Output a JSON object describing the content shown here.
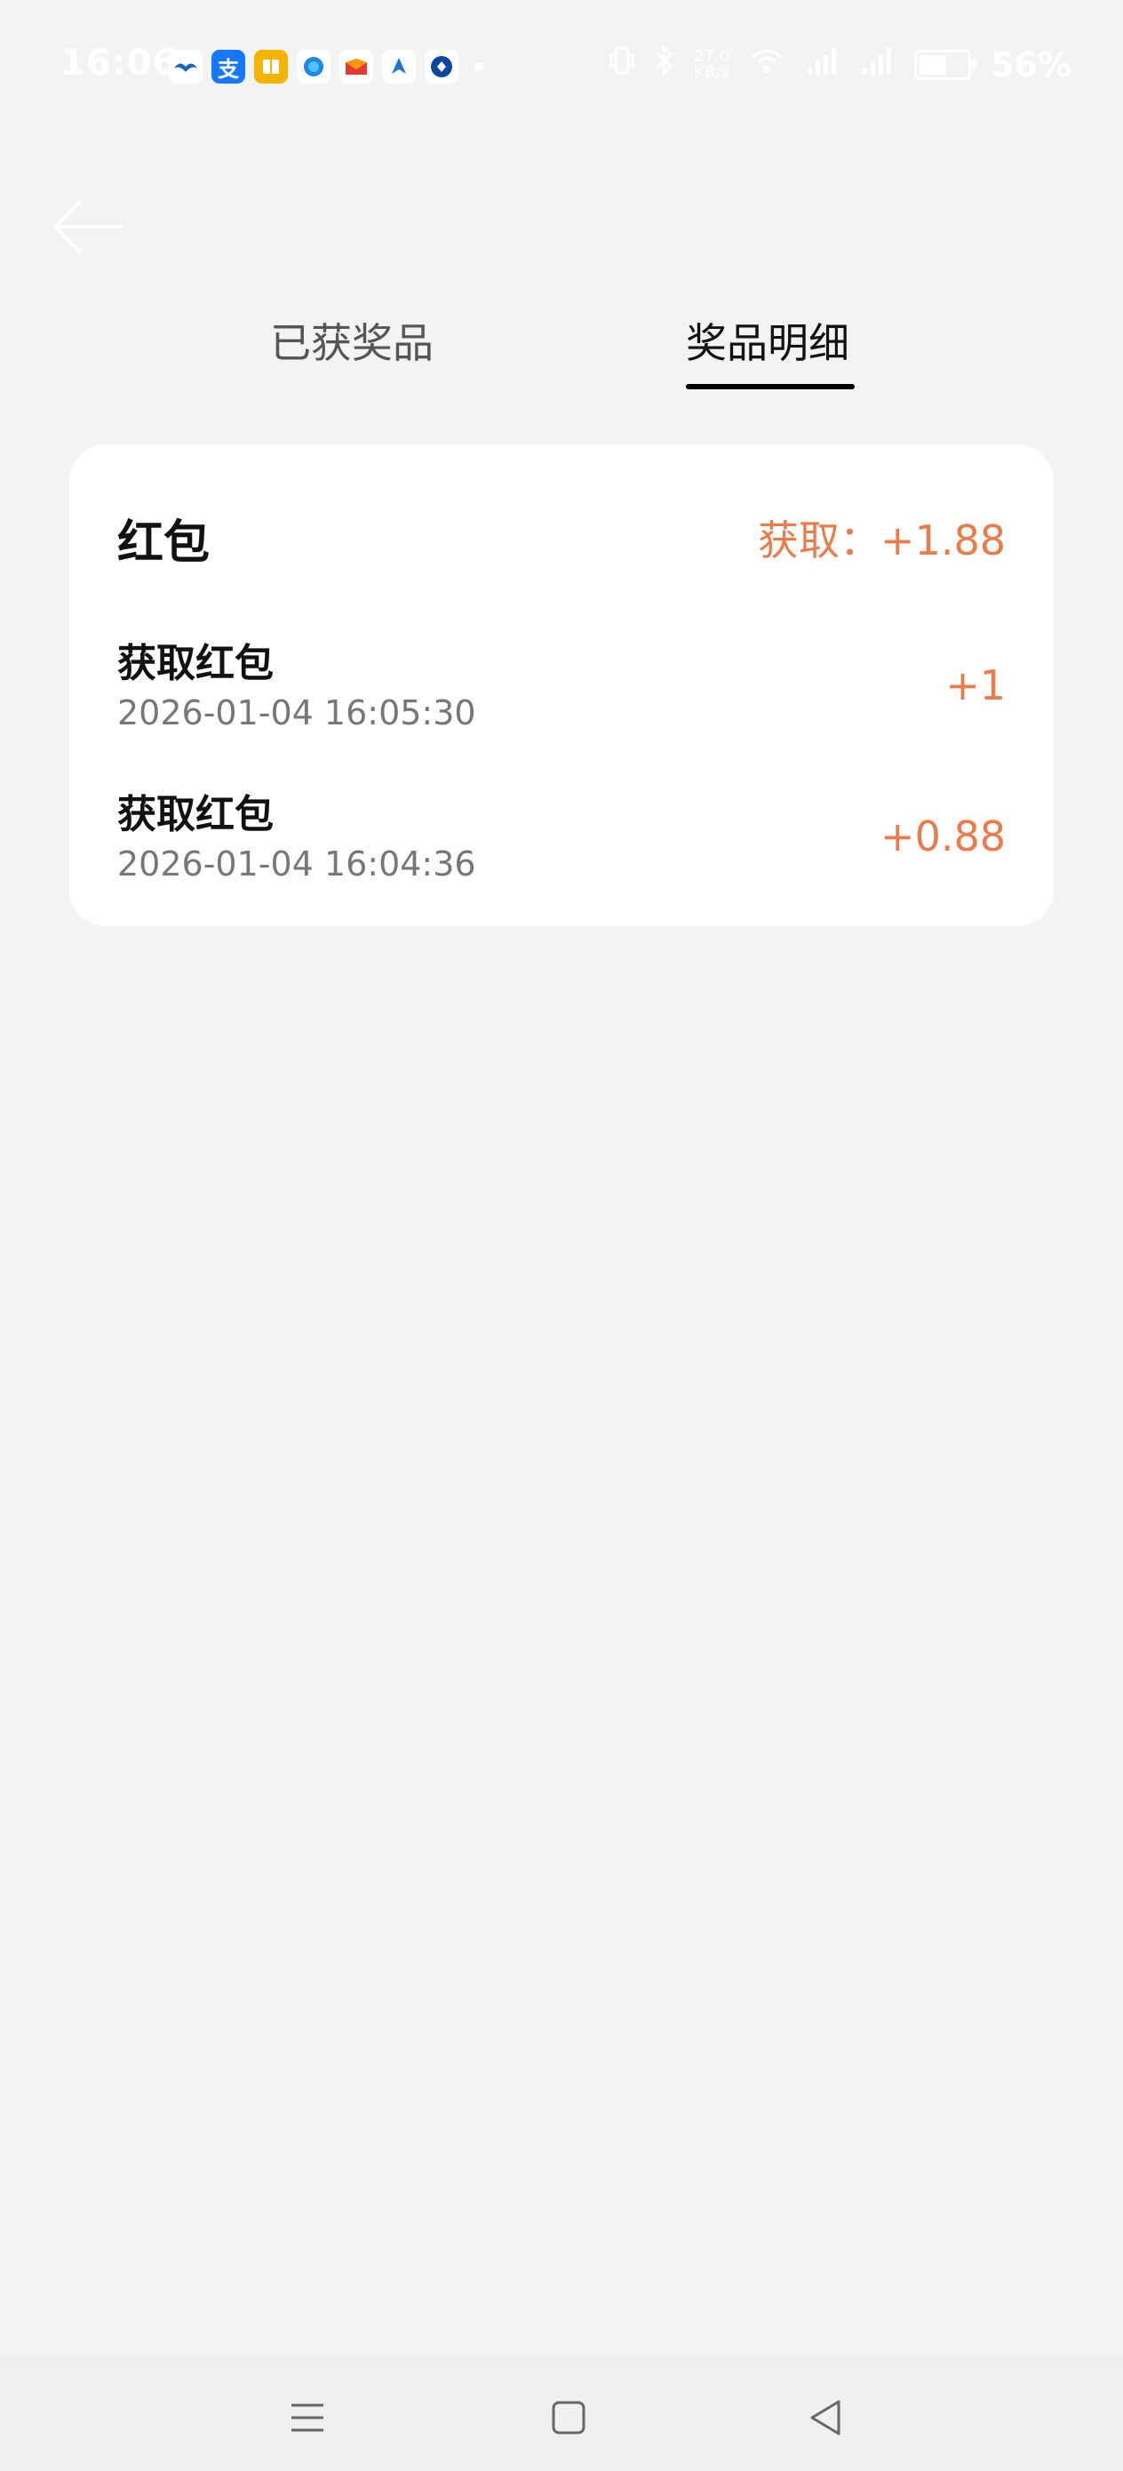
{
  "status_bar": {
    "time": "16:06",
    "network_speed_value": "27.0",
    "network_speed_unit": "KB/s",
    "battery_percent": "56%",
    "notification_icons": [
      "bird-app-icon",
      "alipay-icon",
      "book-app-icon",
      "browser-icon",
      "mail-app-icon",
      "map-app-icon",
      "bank-app-icon"
    ],
    "alipay_glyph": "支"
  },
  "header": {
    "back_icon": "arrow-left-icon"
  },
  "tabs": [
    {
      "label": "已获奖品",
      "active": false
    },
    {
      "label": "奖品明细",
      "active": true
    }
  ],
  "card": {
    "title": "红包",
    "total": "获取：+1.88",
    "records": [
      {
        "title": "获取红包",
        "time": "2026-01-04 16:05:30",
        "amount": "+1"
      },
      {
        "title": "获取红包",
        "time": "2026-01-04 16:04:36",
        "amount": "+0.88"
      }
    ]
  },
  "colors": {
    "accent": "#ea7c4c",
    "background": "#f2f3f5",
    "card": "#ffffff"
  },
  "nav_bar": {
    "icons": [
      "menu-icon",
      "home-icon",
      "back-triangle-icon"
    ]
  }
}
